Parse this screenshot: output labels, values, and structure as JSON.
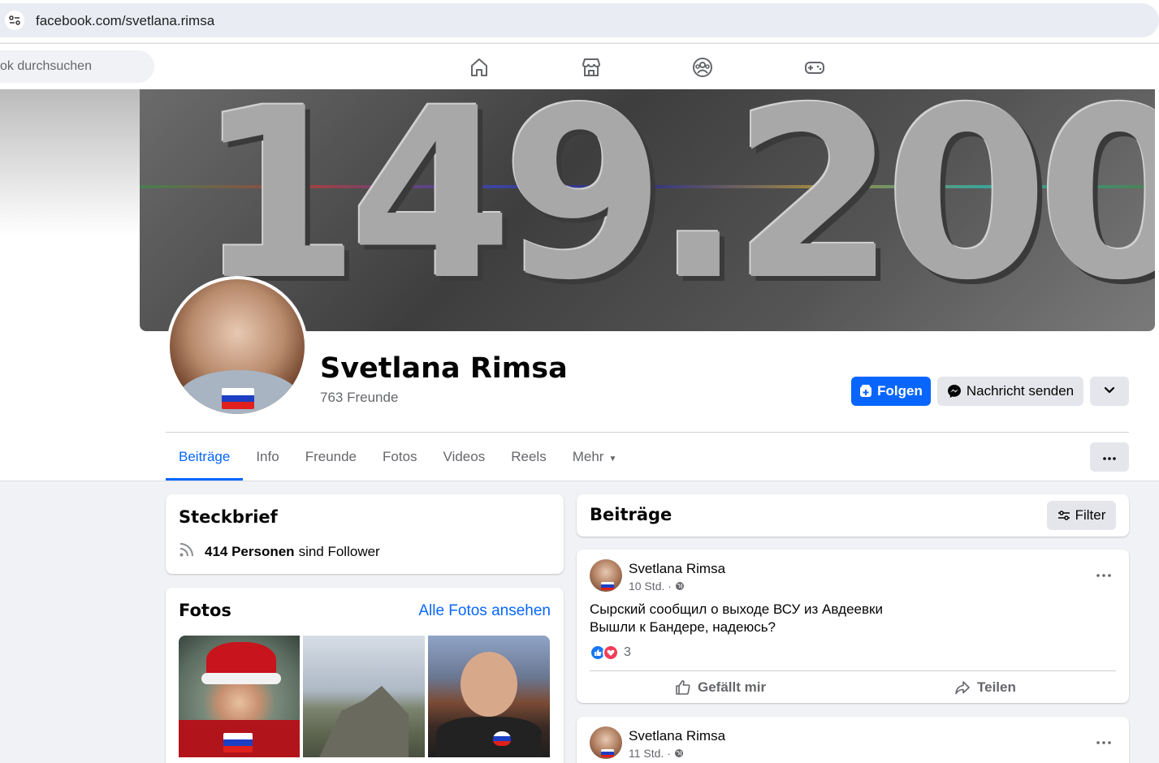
{
  "browser": {
    "url": "facebook.com/svetlana.rimsa"
  },
  "fbnav": {
    "search_placeholder": "ok durchsuchen",
    "icons": [
      "home-icon",
      "marketplace-icon",
      "groups-icon",
      "gaming-icon"
    ]
  },
  "profile": {
    "cover_text": "149.200",
    "name": "Svetlana Rimsa",
    "friends": "763 Freunde",
    "follow_label": "Folgen",
    "message_label": "Nachricht senden"
  },
  "tabs": [
    {
      "label": "Beiträge",
      "active": true
    },
    {
      "label": "Info",
      "active": false
    },
    {
      "label": "Freunde",
      "active": false
    },
    {
      "label": "Fotos",
      "active": false
    },
    {
      "label": "Videos",
      "active": false
    },
    {
      "label": "Reels",
      "active": false
    },
    {
      "label": "Mehr",
      "active": false
    }
  ],
  "intro": {
    "title": "Steckbrief",
    "followers_bold": "414 Personen",
    "followers_rest": "sind Follower"
  },
  "photos": {
    "title": "Fotos",
    "see_all": "Alle Fotos ansehen"
  },
  "posts_header": {
    "title": "Beiträge",
    "filter_label": "Filter"
  },
  "posts": [
    {
      "author": "Svetlana Rimsa",
      "time": "10 Std. ·",
      "line1": "Сырский сообщил о выходе ВСУ из Авдеевки",
      "line2": "Вышли к Бандере, надеюсь?",
      "reaction_count": "3",
      "like_label": "Gefällt mir",
      "share_label": "Teilen"
    },
    {
      "author": "Svetlana Rimsa",
      "time": "11 Std. ·"
    }
  ],
  "colors": {
    "accent": "#0866ff",
    "page_bg": "#f0f2f5",
    "secondary_text": "#65676b"
  }
}
